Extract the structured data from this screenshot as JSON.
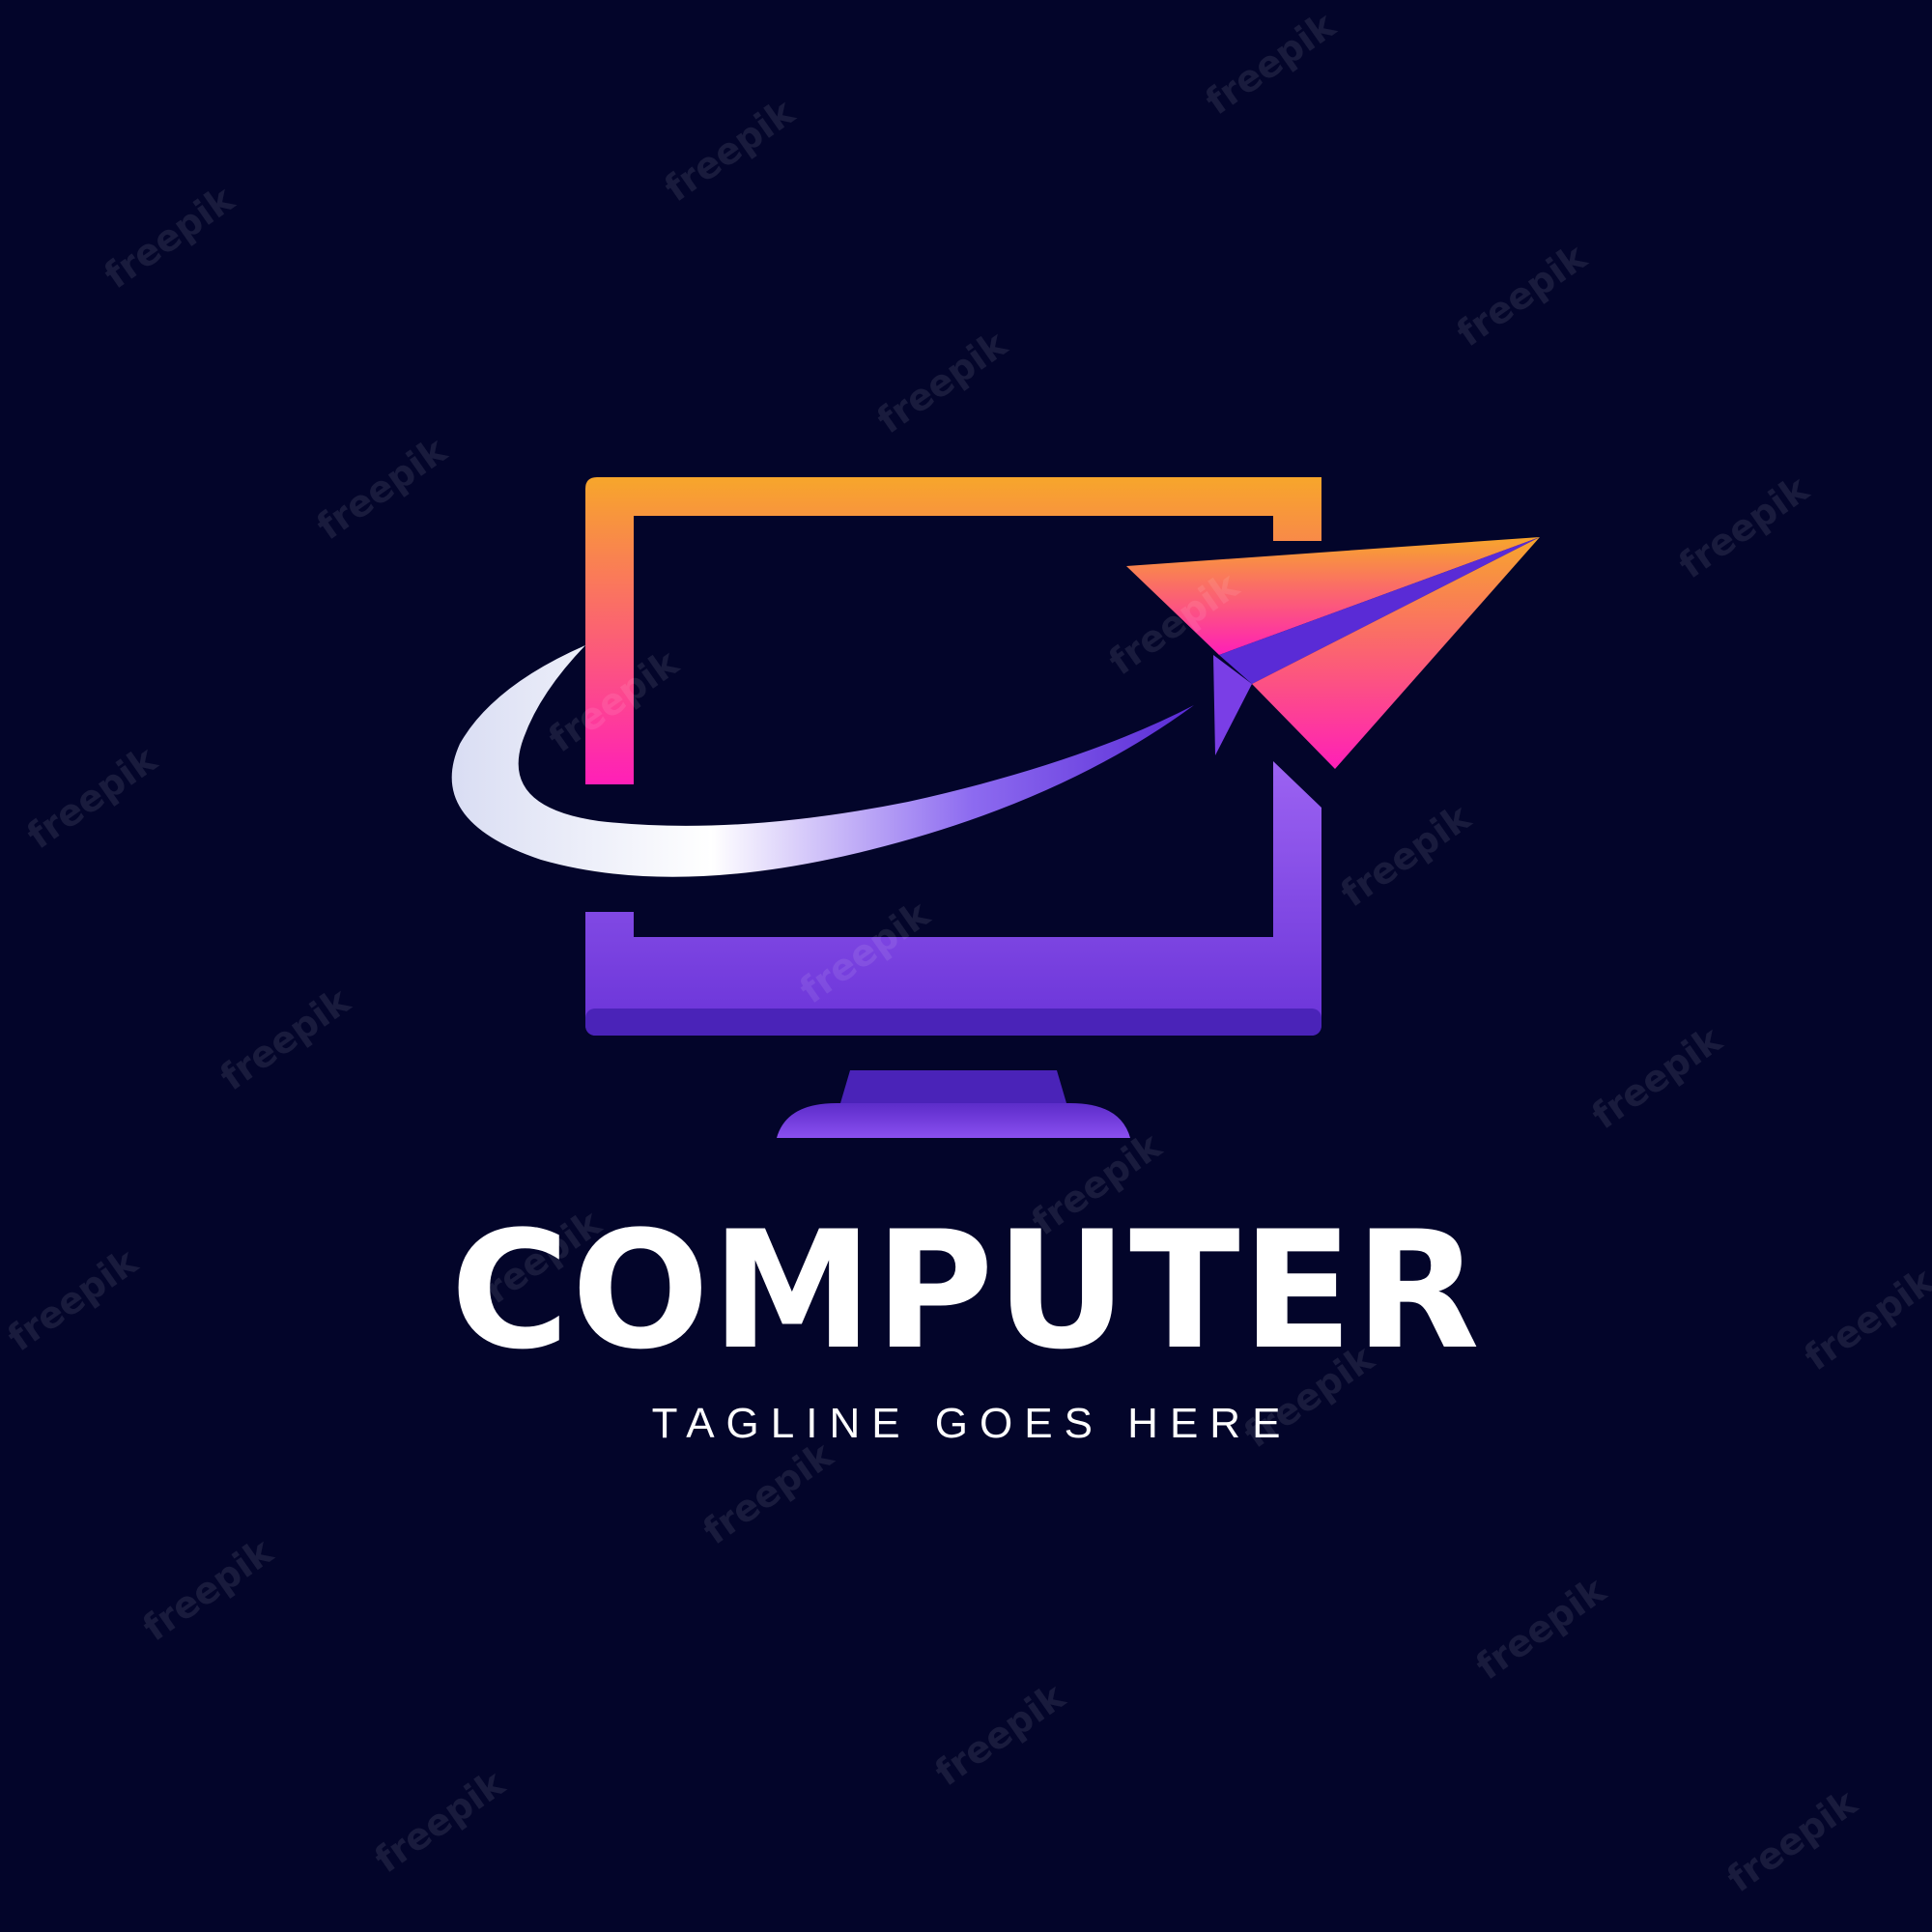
{
  "logo": {
    "brand_name": "COMPUTER",
    "tagline": "TAGLINE GOES HERE",
    "watermark_text": "freepik",
    "icons": [
      "monitor-icon",
      "paper-plane-icon",
      "swoosh-icon"
    ]
  },
  "colors": {
    "background": "#03052a",
    "orange": "#f7a62b",
    "pink": "#ff1fb8",
    "purple": "#9a5cf0",
    "deep_purple": "#5a2bd6",
    "text": "#ffffff"
  }
}
